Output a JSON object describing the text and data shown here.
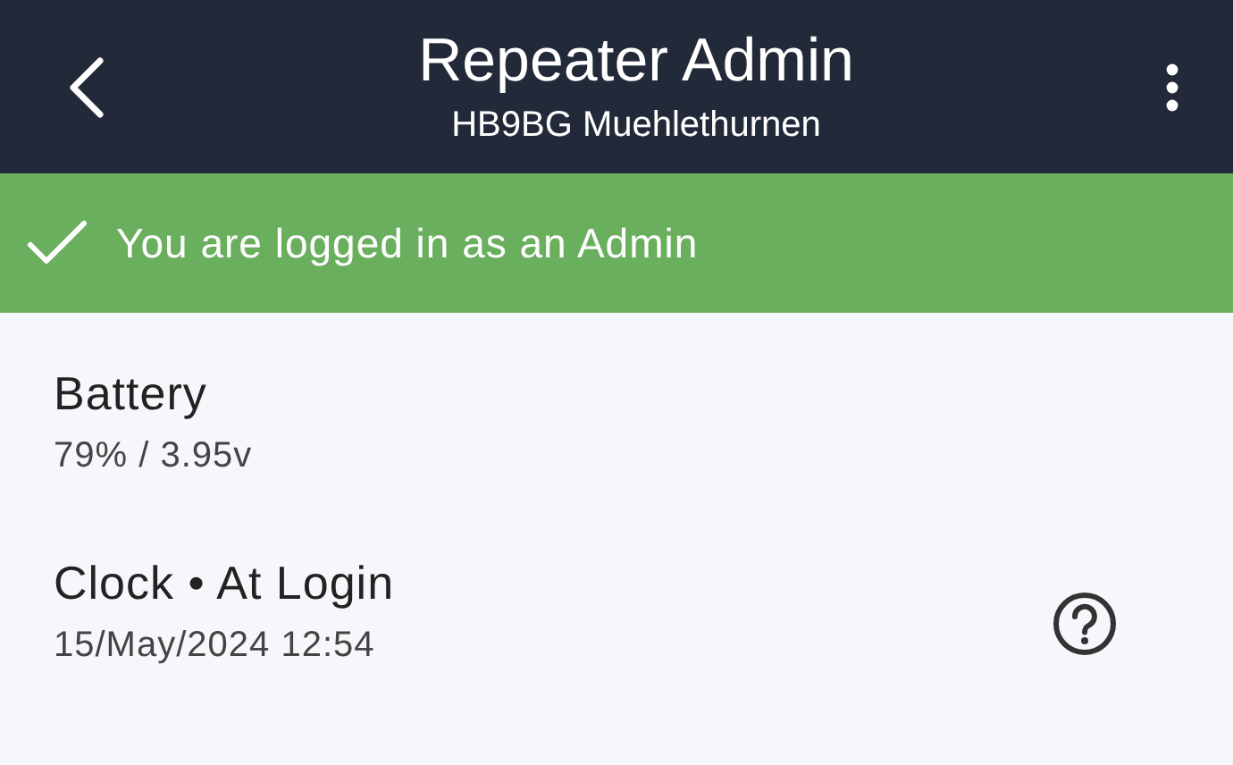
{
  "header": {
    "title": "Repeater Admin",
    "subtitle": "HB9BG Muehlethurnen"
  },
  "banner": {
    "text": "You are logged in as an Admin"
  },
  "items": [
    {
      "kind": "plain",
      "label": "Battery",
      "value": "79% / 3.95v"
    },
    {
      "kind": "help",
      "label": "Clock • At Login",
      "value": "15/May/2024 12:54"
    }
  ]
}
